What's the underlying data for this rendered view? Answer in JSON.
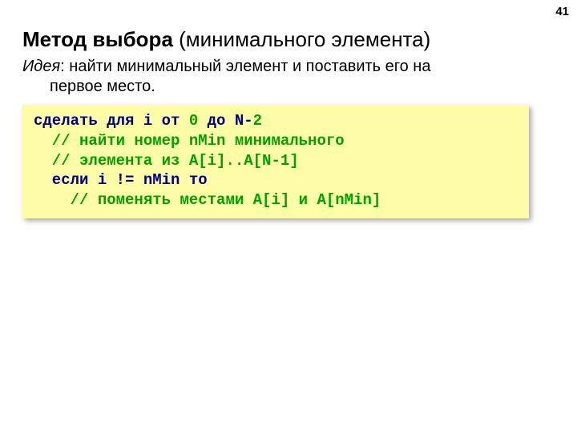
{
  "page_number": "41",
  "title": {
    "bold": "Метод выбора",
    "rest": " (минимального элемента)"
  },
  "idea": {
    "label": "Идея",
    "text_line1": ": найти минимальный элемент и поставить его на",
    "text_line2": "первое место."
  },
  "code": {
    "l1_a": "сделать для i от ",
    "l1_zero": "0",
    "l1_b": " до ",
    "l1_N": "N",
    "l1_dash": "-",
    "l1_two": "2",
    "l2": "  // найти номер nMin минимального ",
    "l3": "  // элемента из A[i]..A[N-1]  ",
    "l4": "  если i != nMin то ",
    "l5": "    // поменять местами A[i] и A[nMin]"
  }
}
